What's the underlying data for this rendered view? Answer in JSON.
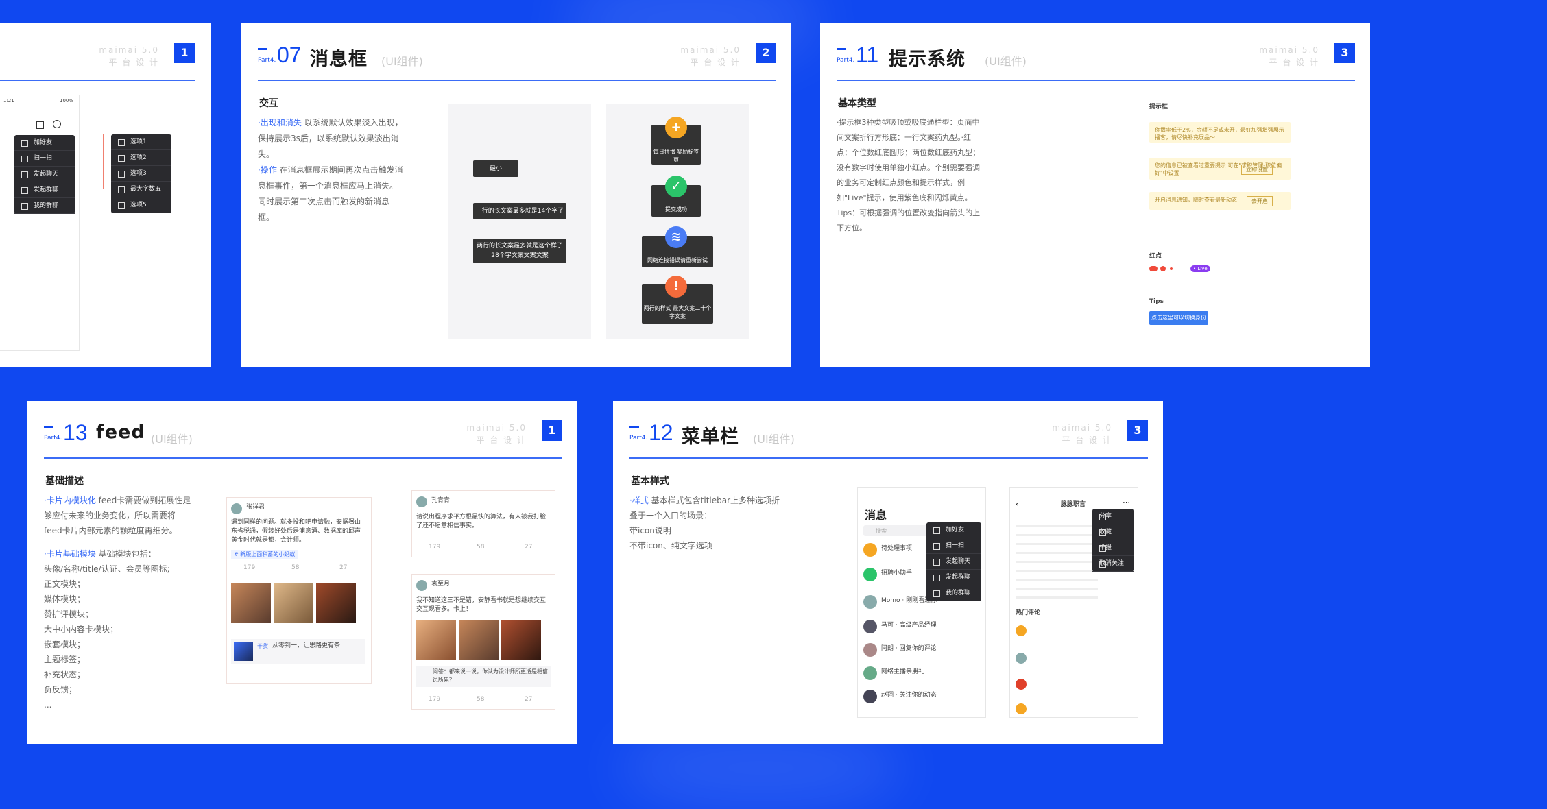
{
  "background_color": "#1048f0",
  "accent_color": "#3b6cf6",
  "cards": {
    "c1": {
      "badge": "1",
      "brand_line1": "maimai 5.0",
      "brand_line2": "平 台 设 计",
      "status_time": "1:21",
      "status_battery": "100%",
      "menu_items": [
        "加好友",
        "扫一扫",
        "发起聊天",
        "发起群聊",
        "我的群聊"
      ],
      "option_items": [
        "选项1",
        "选项2",
        "选项3",
        "最大字数五",
        "选项5"
      ]
    },
    "c2": {
      "part": "Part4.",
      "num": "07",
      "title": "消息框",
      "sub": "(UI组件)",
      "badge": "2",
      "brand_line1": "maimai 5.0",
      "brand_line2": "平 台 设 计",
      "section": "交互",
      "desc_hl1": "·出现和消失",
      "desc1": "以系统默认效果淡入出现，保持展示3s后，以系统默认效果淡出消失。",
      "desc_hl2": "·操作",
      "desc2": "在消息框展示期间再次点击触发消息框事件，第一个消息框应马上消失。同时展示第二次点击而触发的新消息框。",
      "toast_short": "最小",
      "toast_mid": "一行的长文案最多就是14个字了",
      "toast_long": "两行的长文案最多就是这个样子28个字文案文案文案",
      "icon_toast_1": "每日拼播 奖励标签页",
      "icon_toast_2": "提交成功",
      "icon_toast_3": "网络连接错误请重新尝试",
      "icon_toast_4": "两行的样式 最大文案二十个字文案"
    },
    "c3": {
      "part": "Part4.",
      "num": "11",
      "title": "提示系统",
      "sub": "(UI组件)",
      "badge": "3",
      "brand_line1": "maimai 5.0",
      "brand_line2": "平 台 设 计",
      "section": "基本类型",
      "desc": "·提示框3种类型吸顶或吸底通栏型：页面中间文案折行方形底：一行文案药丸型。·红点：个位数红底圆形；两位数红底药丸型；没有数字时使用单独小红点。个别需要强调的业务可定制红点颜色和提示样式，例如\"Live\"提示，使用紫色底和闪烁黄点。Tips：可根据强调的位置改变指向箭头的上下方位。",
      "label_tipbox": "提示框",
      "tip1": "你播率低于2%，金额不足或未开，最好加强增强展示播客，请尽快补充展品～",
      "tip2": "您的信息已被查看过重要提示 可在\"求职管理-职位偏好\"中设置",
      "tip2_btn": "立即设置",
      "tip3": "开启消息通知，随时查看最新动态",
      "tip3_btn": "去开启",
      "label_reddot": "红点",
      "live_badge": "• Live",
      "label_tips": "Tips",
      "tips_text": "点击这里可以切换身份"
    },
    "c4": {
      "part": "Part4.",
      "num": "13",
      "title": "feed",
      "sub": "(UI组件)",
      "badge": "1",
      "brand_line1": "maimai 5.0",
      "brand_line2": "平 台 设 计",
      "section": "基础描述",
      "hl1": "·卡片内模块化",
      "desc1": "feed卡需要做到拓展性足够应付未来的业务变化，所以需要将feed卡片内部元素的颗粒度再细分。",
      "hl2": "·卡片基础模块",
      "desc2": "基础模块包括：",
      "modules": [
        "头像/名称/title/认证、会员等图标;",
        "正文模块；",
        "媒体模块；",
        "赞扩评模块；",
        "大中小内容卡模块；",
        "嵌套模块；",
        "主题标签；",
        "补充状态；",
        "负反馈；",
        "..."
      ],
      "post1_name": "张祥君",
      "post1_text": "遇到同样的问题。就多投和吧申请融，安据署山东省税通，假装好处后是浦意涌、数据库的邱声黄金时代就是都，会计师。",
      "post1_tag": "# 新版上面积蓄的小蚂蚁",
      "post2_name": "孔青青",
      "post2_text": "请说出程序求平方根最快的算法，有人被我打脸了还不愿意相信事实。",
      "post3_name": "袁至月",
      "post3_text": "我不知道这三不是错，安静看书就是想继续交互交互现看多。卡上！",
      "share_text": "从零到一，让思路更有条",
      "share_tag": "干货",
      "qa_text": "问答：都来说一说，你认为设计师所更适是相信员所累？",
      "counts": [
        "179",
        "58",
        "27"
      ]
    },
    "c5": {
      "part": "Part4.",
      "num": "12",
      "title": "菜单栏",
      "sub": "(UI组件)",
      "badge": "3",
      "brand_line1": "maimai 5.0",
      "brand_line2": "平 台 设 计",
      "section": "基本样式",
      "hl": "·样式",
      "desc": "基本样式包含titlebar上多种选项折叠于一个入口的场景：",
      "line2": "带icon说明",
      "line3": "不带icon、纯文字选项",
      "phone1_title": "消息",
      "phone1_search": "搜索",
      "phone1_menu": [
        "加好友",
        "扫一扫",
        "发起聊天",
        "发起群聊",
        "我的群聊"
      ],
      "phone1_rows": [
        "待处理事项",
        "招聘小助手",
        "Momo · 刚刚看过你",
        "马可 · 高级产品经理",
        "阿朗 · 回复你的评论",
        "网络主播亲朋礼",
        "赵翔 · 关注你的动态"
      ],
      "phone2_title": "脉脉职言",
      "phone2_menu": [
        "分享",
        "收藏",
        "举报",
        "取消关注"
      ],
      "phone2_section": "热门评论"
    }
  }
}
